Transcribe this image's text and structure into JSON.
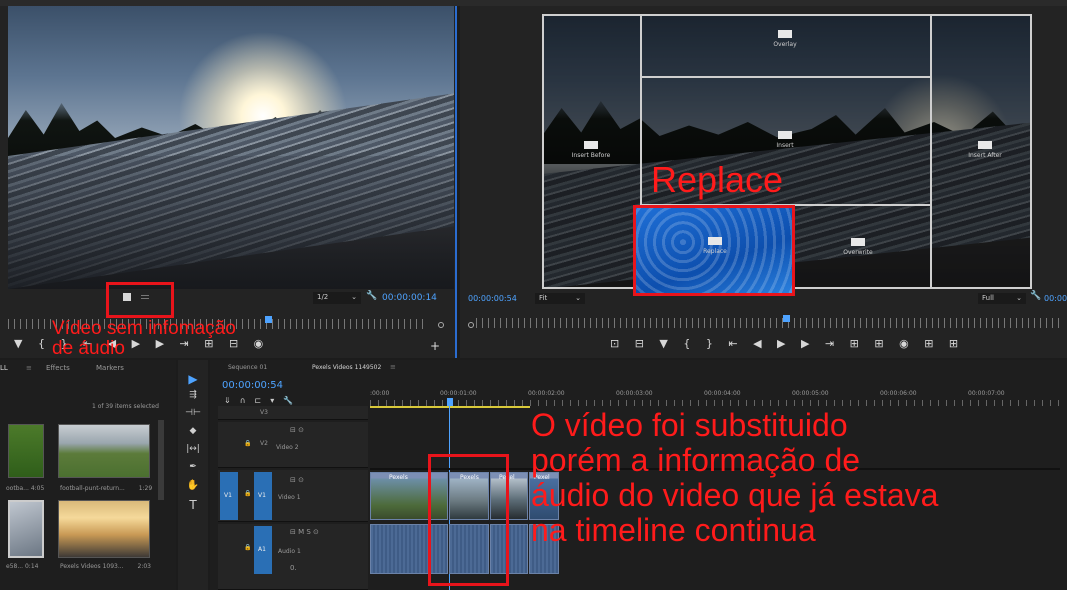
{
  "source_monitor": {
    "zoom": "1/2",
    "timecode": "00:00:00:14",
    "controls": "▼ { } ⇤ ◀ ▶ ▶ ⇥ ⊞ ⊟ ◉"
  },
  "program_monitor": {
    "timecode": "00:00:00:54",
    "fit": "Fit",
    "quality": "Full",
    "timecode_right": "00:00:00:",
    "drop_zones": {
      "overlay": "Overlay",
      "insert_before": "Insert Before",
      "insert": "Insert",
      "insert_after": "Insert After",
      "replace": "Replace",
      "overwrite": "Overwrite"
    },
    "controls": "⊡ ⊟ ▼ { } ⇤ ◀ ▶ ▶ ⇥ ⊞ ⊞ ◉ ⊞ ⊞"
  },
  "project_panel": {
    "tabs": [
      "LL",
      "Effects",
      "Markers"
    ],
    "items_selected": "1 of 39 items selected",
    "items": [
      {
        "name": "ootba...",
        "duration": "4:05"
      },
      {
        "name": "football-punt-return...",
        "duration": "1:29"
      },
      {
        "name": "e58...",
        "duration": "0:14"
      },
      {
        "name": "Pexels Videos 1093...",
        "duration": "2:03"
      }
    ]
  },
  "timeline": {
    "tabs": [
      "Sequence 01",
      "Pexels Videos 1149502"
    ],
    "timecode": "00:00:00:54",
    "ruler_labels": [
      ":00:00",
      "00:00:01:00",
      "00:00:02:00",
      "00:00:03:00",
      "00:00:04:00",
      "00:00:05:00",
      "00:00:06:00",
      "00:00:07:00"
    ],
    "tracks": [
      {
        "id": "V3",
        "name": ""
      },
      {
        "id": "V2",
        "name": "Video 2"
      },
      {
        "id": "V1",
        "name": "Video 1",
        "source": "V1"
      },
      {
        "id": "A1",
        "name": "Audio 1"
      }
    ],
    "clip_labels": [
      "Pexels",
      "Pexels",
      "Pexel",
      "Pexel"
    ],
    "audio_level": "0."
  },
  "annotations": {
    "source_note": "Vídeo sem infomação\nde áudio",
    "replace": "Replace",
    "timeline_note": "O vídeo foi substituido\nporém a informação de\náudio do video que já estava\nna timeline continua"
  },
  "colors": {
    "annotation_red": "#e8141b",
    "timecode_blue": "#4ea3ff",
    "panel_bg": "#1e1e1e"
  }
}
